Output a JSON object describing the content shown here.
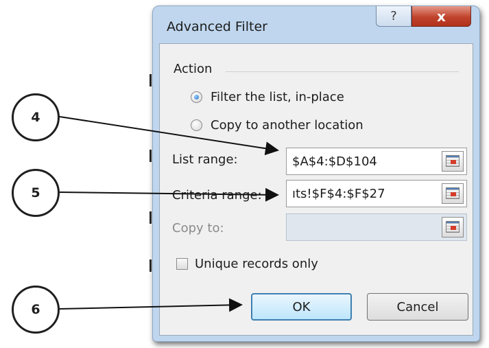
{
  "dialog": {
    "title": "Advanced Filter",
    "help_icon": "question-mark",
    "close_icon": "x",
    "help_label": "?",
    "close_label": "x"
  },
  "action": {
    "group_label": "Action",
    "options": [
      {
        "label": "Filter the list, in-place",
        "selected": true
      },
      {
        "label": "Copy to another location",
        "selected": false
      }
    ]
  },
  "fields": {
    "list_range": {
      "label": "List range:",
      "value": "$A$4:$D$104"
    },
    "criteria_range": {
      "label": "Criteria range:",
      "value": "ıts!$F$4:$F$27"
    },
    "copy_to": {
      "label": "Copy to:",
      "value": "",
      "disabled": true
    }
  },
  "unique_records": {
    "label": "Unique records only",
    "checked": false
  },
  "buttons": {
    "ok": "OK",
    "cancel": "Cancel"
  },
  "callouts": [
    "4",
    "5",
    "6"
  ],
  "colors": {
    "title_bar": "#bfd6ee",
    "close_button": "#c0432c",
    "ok_border": "#3c7fb1"
  }
}
